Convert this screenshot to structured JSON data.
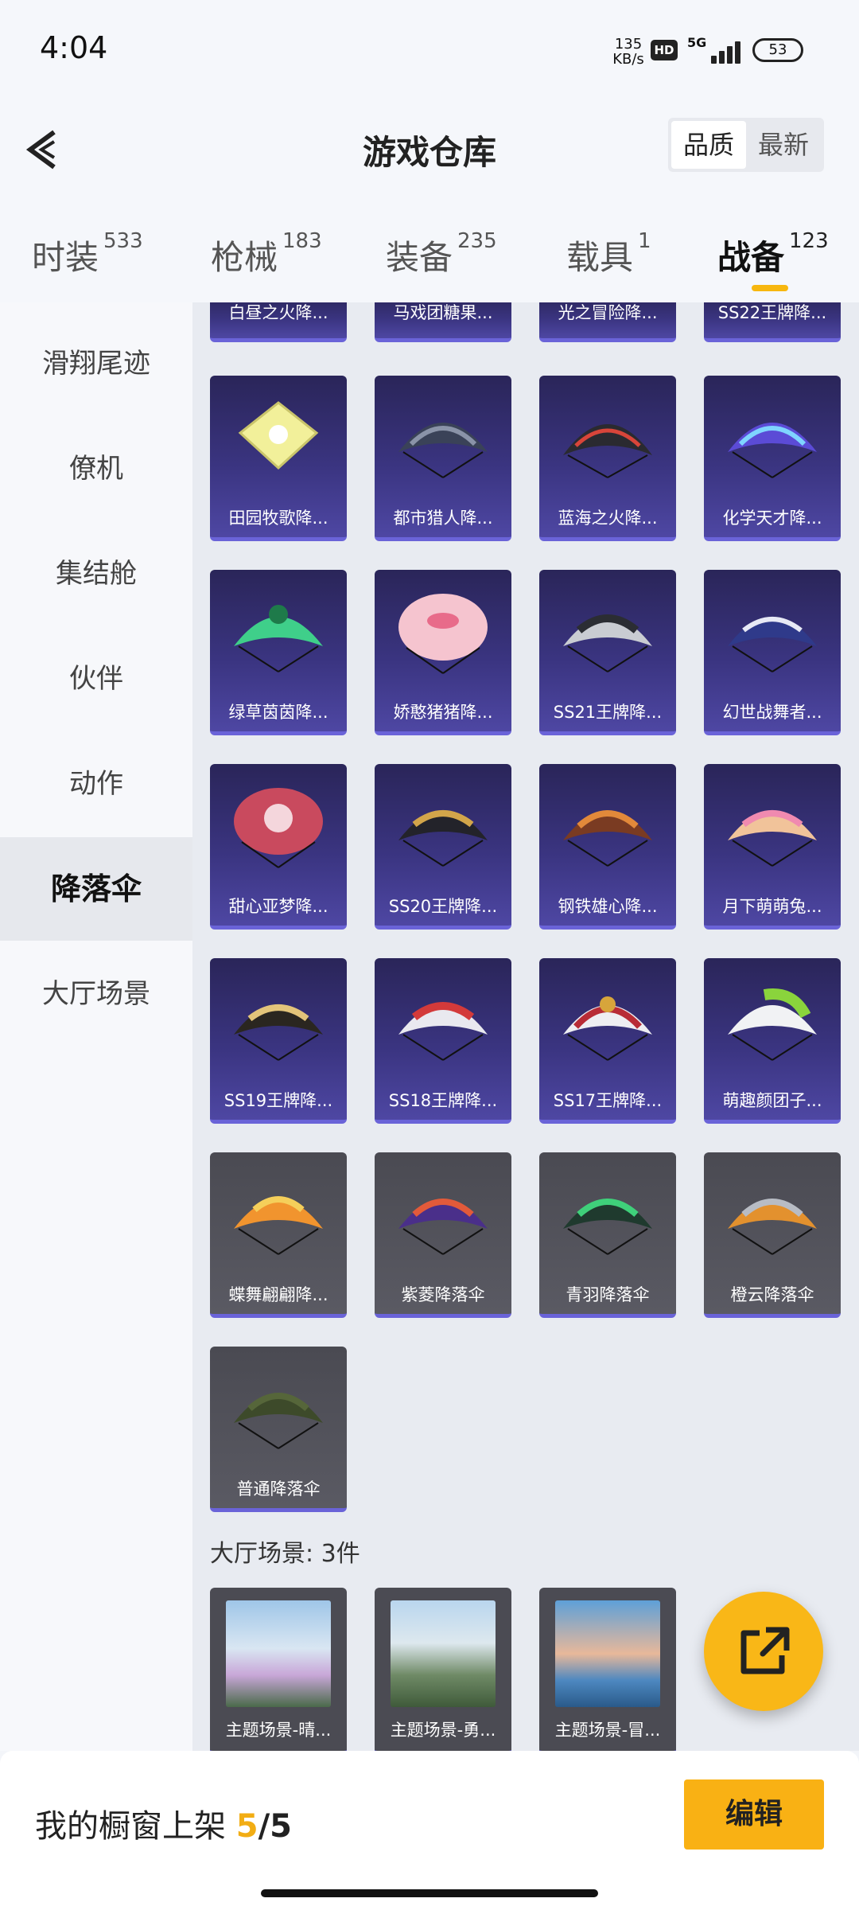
{
  "status_bar": {
    "time": "4:04",
    "net_speed_value": "135",
    "net_speed_unit": "KB/s",
    "hd_badge": "HD",
    "network": "5G",
    "battery": "53"
  },
  "header": {
    "title": "游戏仓库",
    "sort_options": [
      "品质",
      "最新"
    ],
    "active_sort": "品质"
  },
  "tabs": [
    {
      "label": "时装",
      "count": "533"
    },
    {
      "label": "枪械",
      "count": "183"
    },
    {
      "label": "装备",
      "count": "235"
    },
    {
      "label": "载具",
      "count": "1"
    },
    {
      "label": "战备",
      "count": "123",
      "active": true
    }
  ],
  "side_nav": [
    "滑翔尾迹",
    "僚机",
    "集结舱",
    "伙伴",
    "动作",
    "降落伞",
    "大厅场景"
  ],
  "side_nav_active": "降落伞",
  "parachutes": {
    "row0_partial": [
      "白昼之火降...",
      "马戏团糖果...",
      "光之冒险降...",
      "SS22王牌降..."
    ],
    "row1": [
      "田园牧歌降...",
      "都市猎人降...",
      "蓝海之火降...",
      "化学天才降..."
    ],
    "row2": [
      "绿草茵茵降...",
      "娇憨猪猪降...",
      "SS21王牌降...",
      "幻世战舞者..."
    ],
    "row3": [
      "甜心亚梦降...",
      "SS20王牌降...",
      "钢铁雄心降...",
      "月下萌萌兔..."
    ],
    "row4": [
      "SS19王牌降...",
      "SS18王牌降...",
      "SS17王牌降...",
      "萌趣颜团子..."
    ],
    "row5": [
      "蝶舞翩翩降...",
      "紫菱降落伞",
      "青羽降落伞",
      "橙云降落伞"
    ],
    "row6": [
      "普通降落伞"
    ]
  },
  "lobby_scenes": {
    "section_label": "大厅场景: 3件",
    "items": [
      "主题场景-晴...",
      "主题场景-勇...",
      "主题场景-冒..."
    ]
  },
  "bottom_bar": {
    "label": "我的橱窗上架",
    "used": "5",
    "separator": "/",
    "total": "5",
    "edit_label": "编辑"
  },
  "colors": {
    "accent": "#f9b114",
    "rare_card": "#3a3480",
    "common_card": "#55555d",
    "highlight_line": "#6a63d8"
  }
}
